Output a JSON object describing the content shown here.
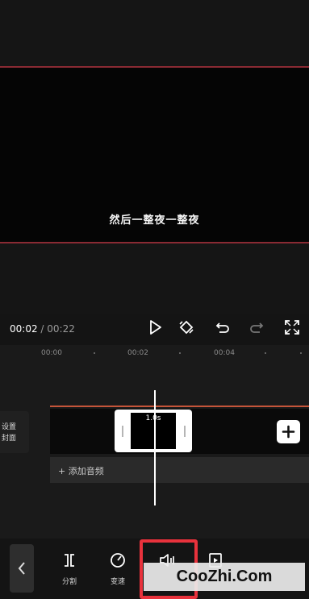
{
  "preview": {
    "subtitle": "然后一整夜一整夜"
  },
  "controls": {
    "current_time": "00:02",
    "separator": " / ",
    "total_time": "00:22"
  },
  "ruler": {
    "labels": [
      "00:00",
      "00:02",
      "00:04"
    ]
  },
  "cover": {
    "line1": "设置",
    "line2": "封面"
  },
  "clip": {
    "duration": "1.0s"
  },
  "audio": {
    "add_label": "+ 添加音频"
  },
  "toolbar": {
    "split_label": "分割",
    "speed_label": "变速"
  },
  "watermark": {
    "text": "CooZhi.Com"
  },
  "colors": {
    "highlight": "#e8323c",
    "track_line": "#c5553a",
    "preview_border": "#8a2a33"
  }
}
